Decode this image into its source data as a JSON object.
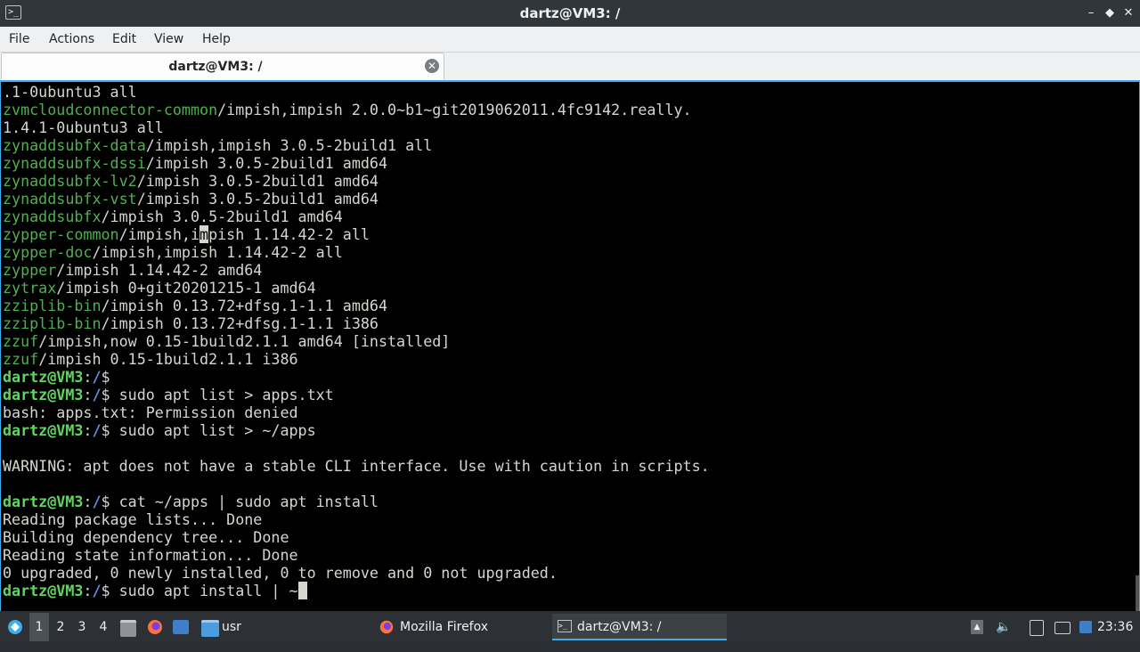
{
  "window": {
    "title": "dartz@VM3: /",
    "icon": "terminal-icon",
    "buttons": {
      "minimize": "–",
      "restore": "◆",
      "close": "✕"
    }
  },
  "menubar": [
    "File",
    "Actions",
    "Edit",
    "View",
    "Help"
  ],
  "tab": {
    "label": "dartz@VM3: /",
    "close": "✕"
  },
  "colors": {
    "package": "#4eb04e",
    "prompt_user": "#5fd75f",
    "prompt_path": "#5c8fe6",
    "text": "#d3d7cf",
    "accent": "#3daee9"
  },
  "terminal_lines": [
    [
      {
        "t": ".1-0ubuntu3 all",
        "c": "plain"
      }
    ],
    [
      {
        "t": "zvmcloudconnector-common",
        "c": "pkg"
      },
      {
        "t": "/impish,impish 2.0.0~b1~git2019062011.4fc9142.really.",
        "c": "plain"
      }
    ],
    [
      {
        "t": "1.4.1-0ubuntu3 all",
        "c": "plain"
      }
    ],
    [
      {
        "t": "zynaddsubfx-data",
        "c": "pkg"
      },
      {
        "t": "/impish,impish 3.0.5-2build1 all",
        "c": "plain"
      }
    ],
    [
      {
        "t": "zynaddsubfx-dssi",
        "c": "pkg"
      },
      {
        "t": "/impish 3.0.5-2build1 amd64",
        "c": "plain"
      }
    ],
    [
      {
        "t": "zynaddsubfx-lv2",
        "c": "pkg"
      },
      {
        "t": "/impish 3.0.5-2build1 amd64",
        "c": "plain"
      }
    ],
    [
      {
        "t": "zynaddsubfx-vst",
        "c": "pkg"
      },
      {
        "t": "/impish 3.0.5-2build1 amd64",
        "c": "plain"
      }
    ],
    [
      {
        "t": "zynaddsubfx",
        "c": "pkg"
      },
      {
        "t": "/impish 3.0.5-2build1 amd64",
        "c": "plain"
      }
    ],
    [
      {
        "t": "zypper-common",
        "c": "pkg"
      },
      {
        "t": "/impish,i",
        "c": "plain"
      },
      {
        "t": "m",
        "c": "cursor"
      },
      {
        "t": "pish 1.14.42-2 all",
        "c": "plain"
      }
    ],
    [
      {
        "t": "zypper-doc",
        "c": "pkg"
      },
      {
        "t": "/impish,impish 1.14.42-2 all",
        "c": "plain"
      }
    ],
    [
      {
        "t": "zypper",
        "c": "pkg"
      },
      {
        "t": "/impish 1.14.42-2 amd64",
        "c": "plain"
      }
    ],
    [
      {
        "t": "zytrax",
        "c": "pkg"
      },
      {
        "t": "/impish 0+git20201215-1 amd64",
        "c": "plain"
      }
    ],
    [
      {
        "t": "zziplib-bin",
        "c": "pkg"
      },
      {
        "t": "/impish 0.13.72+dfsg.1-1.1 amd64",
        "c": "plain"
      }
    ],
    [
      {
        "t": "zziplib-bin",
        "c": "pkg"
      },
      {
        "t": "/impish 0.13.72+dfsg.1-1.1 i386",
        "c": "plain"
      }
    ],
    [
      {
        "t": "zzuf",
        "c": "pkg"
      },
      {
        "t": "/impish,now 0.15-1build2.1.1 amd64 [installed]",
        "c": "plain"
      }
    ],
    [
      {
        "t": "zzuf",
        "c": "pkg"
      },
      {
        "t": "/impish 0.15-1build2.1.1 i386",
        "c": "plain"
      }
    ],
    [
      {
        "t": "dartz@VM3",
        "c": "prompt"
      },
      {
        "t": ":",
        "c": "plain"
      },
      {
        "t": "/",
        "c": "path"
      },
      {
        "t": "$",
        "c": "plain"
      }
    ],
    [
      {
        "t": "dartz@VM3",
        "c": "prompt"
      },
      {
        "t": ":",
        "c": "plain"
      },
      {
        "t": "/",
        "c": "path"
      },
      {
        "t": "$ sudo apt list > apps.txt",
        "c": "plain"
      }
    ],
    [
      {
        "t": "bash: apps.txt: Permission denied",
        "c": "plain"
      }
    ],
    [
      {
        "t": "dartz@VM3",
        "c": "prompt"
      },
      {
        "t": ":",
        "c": "plain"
      },
      {
        "t": "/",
        "c": "path"
      },
      {
        "t": "$ sudo apt list > ~/apps",
        "c": "plain"
      }
    ],
    [
      {
        "t": "",
        "c": "plain"
      }
    ],
    [
      {
        "t": "WARNING: apt does not have a stable CLI interface. Use with caution in scripts.",
        "c": "plain"
      }
    ],
    [
      {
        "t": "",
        "c": "plain"
      }
    ],
    [
      {
        "t": "dartz@VM3",
        "c": "prompt"
      },
      {
        "t": ":",
        "c": "plain"
      },
      {
        "t": "/",
        "c": "path"
      },
      {
        "t": "$ cat ~/apps | sudo apt install",
        "c": "plain"
      }
    ],
    [
      {
        "t": "Reading package lists... Done",
        "c": "plain"
      }
    ],
    [
      {
        "t": "Building dependency tree... Done",
        "c": "plain"
      }
    ],
    [
      {
        "t": "Reading state information... Done",
        "c": "plain"
      }
    ],
    [
      {
        "t": "0 upgraded, 0 newly installed, 0 to remove and 0 not upgraded.",
        "c": "plain"
      }
    ],
    [
      {
        "t": "dartz@VM3",
        "c": "prompt"
      },
      {
        "t": ":",
        "c": "plain"
      },
      {
        "t": "/",
        "c": "path"
      },
      {
        "t": "$ sudo apt install | ~",
        "c": "plain"
      },
      {
        "t": " ",
        "c": "cursor"
      }
    ]
  ],
  "taskbar": {
    "start_icon": "app-launcher-icon",
    "desktops": [
      "1",
      "2",
      "3",
      "4"
    ],
    "active_desktop": "1",
    "quicklaunch": [
      "file-manager-icon",
      "firefox-icon",
      "show-desktop-icon",
      "folder-icon"
    ],
    "folder_label": "usr",
    "tasks": [
      {
        "icon": "firefox-icon",
        "label": "Mozilla Firefox"
      },
      {
        "icon": "terminal-icon",
        "label": "dartz@VM3: /"
      }
    ],
    "tray": [
      "tray-expand-icon",
      "volume-icon",
      "clipboard-icon",
      "network-icon",
      "monitor-icon",
      "notification-icon"
    ],
    "clock": "23:36"
  }
}
